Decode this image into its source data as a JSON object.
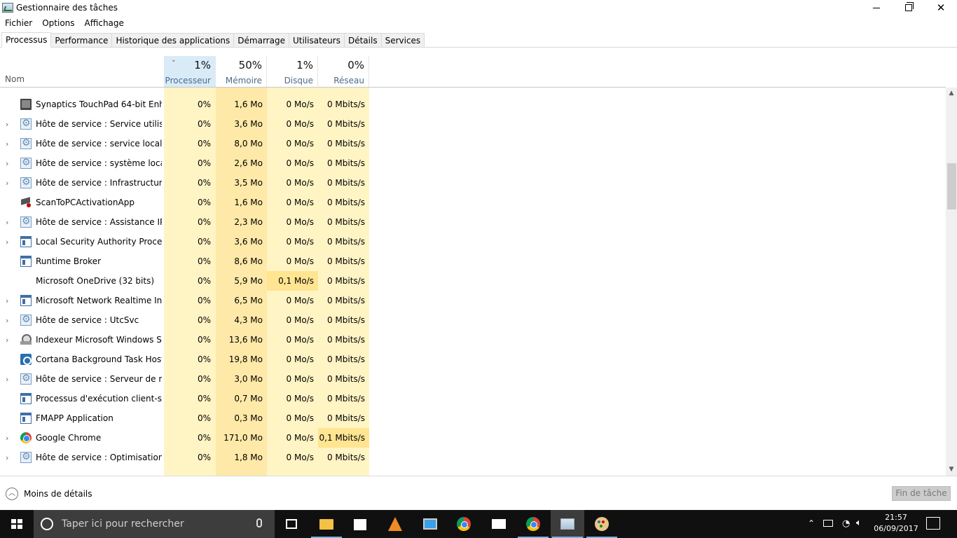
{
  "window": {
    "title": "Gestionnaire des tâches",
    "close_glyph": "✕"
  },
  "menu": [
    "Fichier",
    "Options",
    "Affichage"
  ],
  "tabs": [
    "Processus",
    "Performance",
    "Historique des applications",
    "Démarrage",
    "Utilisateurs",
    "Détails",
    "Services"
  ],
  "active_tab": "Processus",
  "columns": {
    "name_label": "Nom",
    "cpu": {
      "pct": "1%",
      "label": "Processeur"
    },
    "memory": {
      "pct": "50%",
      "label": "Mémoire"
    },
    "disk": {
      "pct": "1%",
      "label": "Disque"
    },
    "network": {
      "pct": "0%",
      "label": "Réseau"
    }
  },
  "rows": [
    {
      "expand": false,
      "icon": "monitor-icon",
      "name": "Synaptics TouchPad 64-bit Enh...",
      "cpu": "0%",
      "mem": "1,6 Mo",
      "disk": "0 Mo/s",
      "net": "0 Mbits/s"
    },
    {
      "expand": true,
      "icon": "gear-icon",
      "name": "Hôte de service : Service utilisat...",
      "cpu": "0%",
      "mem": "3,6 Mo",
      "disk": "0 Mo/s",
      "net": "0 Mbits/s"
    },
    {
      "expand": true,
      "icon": "gear-icon",
      "name": "Hôte de service : service local (a...",
      "cpu": "0%",
      "mem": "8,0 Mo",
      "disk": "0 Mo/s",
      "net": "0 Mbits/s"
    },
    {
      "expand": true,
      "icon": "gear-icon",
      "name": "Hôte de service : système local (...",
      "cpu": "0%",
      "mem": "2,6 Mo",
      "disk": "0 Mo/s",
      "net": "0 Mbits/s"
    },
    {
      "expand": true,
      "icon": "gear-icon",
      "name": "Hôte de service : Infrastructure ...",
      "cpu": "0%",
      "mem": "3,5 Mo",
      "disk": "0 Mo/s",
      "net": "0 Mbits/s"
    },
    {
      "expand": false,
      "icon": "scanner-icon",
      "name": "ScanToPCActivationApp",
      "cpu": "0%",
      "mem": "1,6 Mo",
      "disk": "0 Mo/s",
      "net": "0 Mbits/s"
    },
    {
      "expand": true,
      "icon": "gear-icon",
      "name": "Hôte de service : Assistance IP",
      "cpu": "0%",
      "mem": "2,3 Mo",
      "disk": "0 Mo/s",
      "net": "0 Mbits/s"
    },
    {
      "expand": true,
      "icon": "window-icon",
      "name": "Local Security Authority Proces...",
      "cpu": "0%",
      "mem": "3,6 Mo",
      "disk": "0 Mo/s",
      "net": "0 Mbits/s"
    },
    {
      "expand": false,
      "icon": "window-icon",
      "name": "Runtime Broker",
      "cpu": "0%",
      "mem": "8,6 Mo",
      "disk": "0 Mo/s",
      "net": "0 Mbits/s"
    },
    {
      "expand": false,
      "icon": "none",
      "name": "Microsoft OneDrive (32 bits)",
      "cpu": "0%",
      "mem": "5,9 Mo",
      "disk": "0,1 Mo/s",
      "net": "0 Mbits/s",
      "hl": "disk"
    },
    {
      "expand": true,
      "icon": "window-icon",
      "name": "Microsoft Network Realtime Ins...",
      "cpu": "0%",
      "mem": "6,5 Mo",
      "disk": "0 Mo/s",
      "net": "0 Mbits/s"
    },
    {
      "expand": true,
      "icon": "gear-icon",
      "name": "Hôte de service : UtcSvc",
      "cpu": "0%",
      "mem": "4,3 Mo",
      "disk": "0 Mo/s",
      "net": "0 Mbits/s"
    },
    {
      "expand": true,
      "icon": "indexer-icon",
      "name": "Indexeur Microsoft Windows Se...",
      "cpu": "0%",
      "mem": "13,6 Mo",
      "disk": "0 Mo/s",
      "net": "0 Mbits/s"
    },
    {
      "expand": false,
      "icon": "cortana-icon",
      "name": "Cortana Background Task Host",
      "cpu": "0%",
      "mem": "19,8 Mo",
      "disk": "0 Mo/s",
      "net": "0 Mbits/s"
    },
    {
      "expand": true,
      "icon": "gear-icon",
      "name": "Hôte de service : Serveur de mo...",
      "cpu": "0%",
      "mem": "3,0 Mo",
      "disk": "0 Mo/s",
      "net": "0 Mbits/s"
    },
    {
      "expand": false,
      "icon": "window-icon",
      "name": "Processus d'exécution client-ser...",
      "cpu": "0%",
      "mem": "0,7 Mo",
      "disk": "0 Mo/s",
      "net": "0 Mbits/s"
    },
    {
      "expand": false,
      "icon": "window-icon",
      "name": "FMAPP Application",
      "cpu": "0%",
      "mem": "0,3 Mo",
      "disk": "0 Mo/s",
      "net": "0 Mbits/s"
    },
    {
      "expand": true,
      "icon": "chrome-icon",
      "name": "Google Chrome",
      "cpu": "0%",
      "mem": "171,0 Mo",
      "disk": "0 Mo/s",
      "net": "0,1 Mbits/s",
      "hl": "net"
    },
    {
      "expand": true,
      "icon": "gear-icon",
      "name": "Hôte de service : Optimisation ...",
      "cpu": "0%",
      "mem": "1,8 Mo",
      "disk": "0 Mo/s",
      "net": "0 Mbits/s"
    }
  ],
  "footer": {
    "less_details": "Moins de détails",
    "end_task": "Fin de tâche"
  },
  "taskbar": {
    "search_placeholder": "Taper ici pour rechercher",
    "time": "21:57",
    "date": "06/09/2017"
  },
  "colors": {
    "cpu_bg": "#fff4c4",
    "mem_bg": "#ffe9a8",
    "header_sorted": "#d9ebf7",
    "taskbar": "#101010"
  }
}
